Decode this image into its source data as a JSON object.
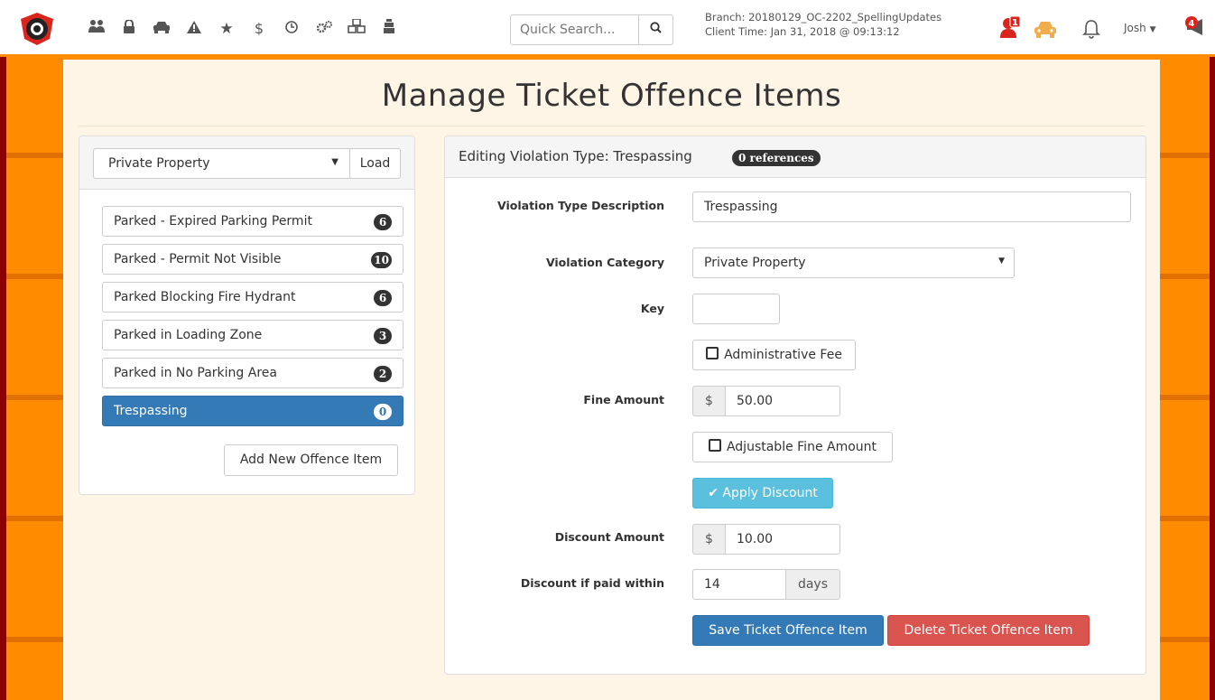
{
  "navbar": {
    "search_placeholder": "Quick Search...",
    "branch": "Branch: 20180129_OC-2202_SpellingUpdates",
    "client_time": "Client Time: Jan 31, 2018 @ 09:13:12",
    "user": "Josh",
    "user_alert_count": "1",
    "notification_count": "4",
    "icons": [
      "users-icon",
      "lock-icon",
      "car-icon",
      "warning-icon",
      "star-icon",
      "dollar-icon",
      "clock-icon",
      "cogs-icon",
      "cubes-icon",
      "road-icon"
    ]
  },
  "page": {
    "title": "Manage Ticket Offence Items"
  },
  "left": {
    "category": "Private Property",
    "load_label": "Load",
    "items": [
      {
        "label": "Parked - Expired Parking Permit",
        "count": "6"
      },
      {
        "label": "Parked - Permit Not Visible",
        "count": "10"
      },
      {
        "label": "Parked Blocking Fire Hydrant",
        "count": "6"
      },
      {
        "label": "Parked in Loading Zone",
        "count": "3"
      },
      {
        "label": "Parked in No Parking Area",
        "count": "2"
      },
      {
        "label": "Trespassing",
        "count": "0",
        "active": true
      }
    ],
    "add_label": "Add New Offence Item"
  },
  "editor": {
    "heading": "Editing Violation Type: Trespassing",
    "references": "0 references",
    "desc_label": "Violation Type Description",
    "desc_value": "Trespassing",
    "category_label": "Violation Category",
    "category_value": "Private Property",
    "key_label": "Key",
    "key_value": "",
    "admin_fee_label": "Administrative Fee",
    "fine_label": "Fine Amount",
    "currency": "$",
    "fine_value": "50.00",
    "adjustable_label": "Adjustable Fine Amount",
    "apply_discount_label": "Apply Discount",
    "discount_label": "Discount Amount",
    "discount_value": "10.00",
    "within_label": "Discount if paid within",
    "within_value": "14",
    "days_label": "days",
    "save_label": "Save Ticket Offence Item",
    "delete_label": "Delete Ticket Offence Item"
  }
}
